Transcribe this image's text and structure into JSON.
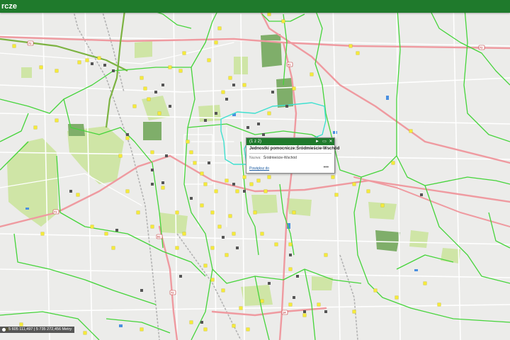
{
  "header": {
    "title_fragment": "rcze"
  },
  "popup": {
    "counter": "(1 z 2)",
    "title": "Jednostki pomocnicze:Śródmieście-Wschód",
    "field_label": "Nazwa:",
    "field_value": "Śródmieście-Wschód",
    "zoom_link": "Powiększ do",
    "more": "•••",
    "controls": {
      "next": "►",
      "dock": "▭",
      "close": "✕"
    }
  },
  "coordinates": {
    "text": "5 605 111,497 | 5 735 272,456 Metry"
  },
  "road_shields": [
    "72",
    "72",
    "91",
    "91",
    "72",
    "71",
    "14"
  ],
  "colors": {
    "header_bg": "#1f7a2c",
    "boundary": "#45d43a",
    "selected_boundary": "#3fe0d0",
    "main_road": "#ef9aa0",
    "park": "#cfe5a6",
    "forest": "#7fae6a",
    "water": "#4a8fe0",
    "marker_yellow": "#f5ea3a",
    "marker_dark": "#555555"
  },
  "icons": {
    "popup_next": "arrow-right-icon",
    "popup_dock": "dock-icon",
    "popup_close": "close-icon",
    "location": "pin-icon"
  }
}
